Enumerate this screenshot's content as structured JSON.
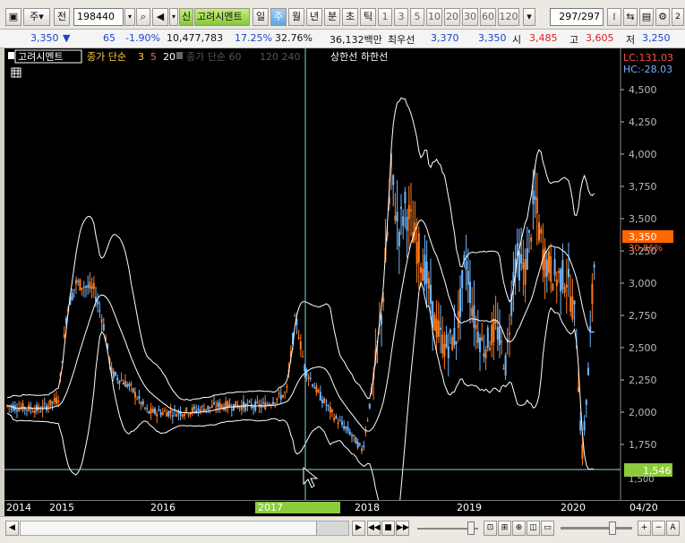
{
  "toolbar": {
    "market": "주",
    "period_label": "전",
    "code": "198440",
    "stock_badge": "신",
    "stock_name": "고려시멘트",
    "tf_day": "일",
    "tf_week": "주",
    "tf_month": "월",
    "tf_year": "년",
    "tf_minute": "분",
    "tf_second": "초",
    "tf_tick": "틱",
    "intervals": [
      "1",
      "3",
      "5",
      "10",
      "20",
      "30",
      "60",
      "120"
    ],
    "page_counter": "297/297"
  },
  "quote": {
    "price": "3,350",
    "change": "65",
    "change_pct": "-1.90%",
    "volume": "10,477,783",
    "turnover_rate": "17.25%",
    "ratio": "32.76%",
    "amount": "36,132백만",
    "best_label": "최우선",
    "ask": "3,370",
    "bid": "3,350",
    "open_label": "시",
    "open": "3,485",
    "high_label": "고",
    "high": "3,605",
    "low_label": "저",
    "low": "3,250"
  },
  "legend": {
    "stock": "고려시멘트",
    "ma_label": "종가 단순",
    "ma_3": "3",
    "ma_5": "5",
    "ma_20": "20",
    "ma2_label": "종가 단순 60",
    "ma2_values": "120  240",
    "limit_label": "상한선 하한선"
  },
  "price_axis": {
    "lc": "LC:131.03",
    "hc": "HC:-28.03",
    "ticks": [
      "4,500",
      "4,250",
      "4,000",
      "3,750",
      "3,500",
      "3,250",
      "3,000",
      "2,750",
      "2,500",
      "2,250",
      "2,000",
      "1,750"
    ],
    "current_price": "3,350",
    "current_pct": "30.86%",
    "cursor_price": "1,546"
  },
  "x_axis": {
    "labels": [
      "2014",
      "2015",
      "2016",
      "2017",
      "2018",
      "2019",
      "2020",
      "04/20"
    ]
  },
  "colors": {
    "up": "#ff7a1a",
    "down": "#6fb8ff",
    "band": "#ffffff",
    "accent": "#ff6600",
    "cursor": "#86d3e0"
  },
  "chart_data": {
    "type": "line",
    "title": "고려시멘트",
    "x": [
      "2014",
      "2015",
      "2016",
      "2017",
      "2018",
      "2019",
      "2020"
    ],
    "series": [
      {
        "name": "종가",
        "values": [
          2050,
          2150,
          2000,
          2100,
          2400,
          3100,
          2700
        ]
      }
    ],
    "ylim": [
      1500,
      4650
    ]
  }
}
